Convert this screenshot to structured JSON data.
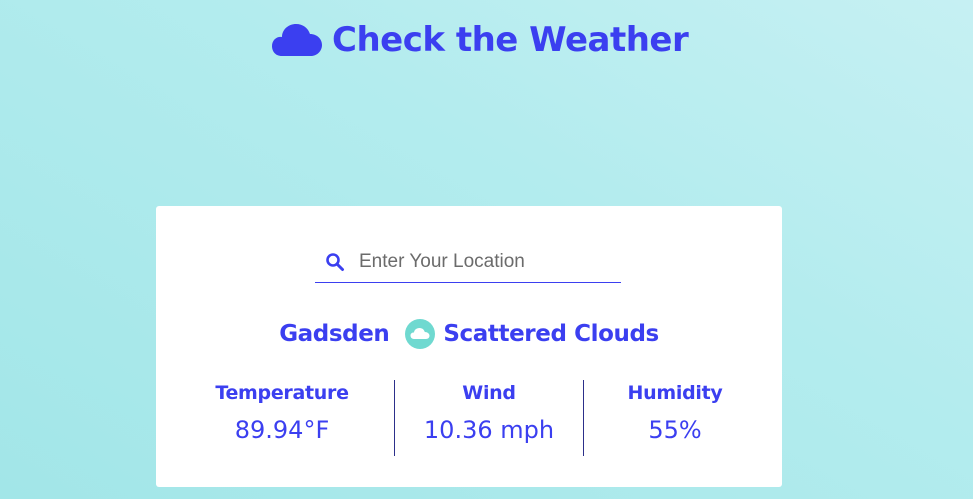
{
  "header": {
    "title": "Check the Weather",
    "icon": "cloud-icon"
  },
  "search": {
    "placeholder": "Enter Your Location",
    "value": "",
    "icon": "search-icon"
  },
  "location": {
    "city": "Gadsden",
    "condition": "Scattered Clouds",
    "condition_icon": "cloud-badge-icon"
  },
  "stats": [
    {
      "label": "Temperature",
      "value": "89.94°F"
    },
    {
      "label": "Wind",
      "value": "10.36 mph"
    },
    {
      "label": "Humidity",
      "value": "55%"
    }
  ],
  "colors": {
    "accent": "#3b3ff0",
    "condition_badge": "#6fd9d0",
    "card": "#ffffff"
  }
}
